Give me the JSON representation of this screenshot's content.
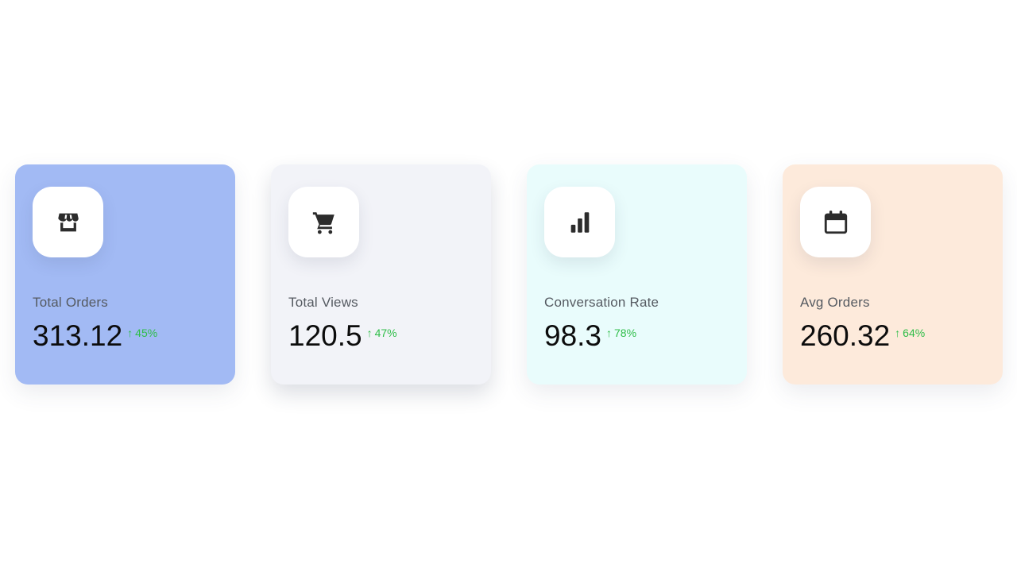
{
  "theme": {
    "positive_color": "#2ebd48",
    "icon_color": "#2c2c2c"
  },
  "cards": [
    {
      "label": "Total Orders",
      "value": "313.12",
      "change": "45%",
      "trend": "up",
      "icon": "store-icon",
      "background": "#a2baf4"
    },
    {
      "label": "Total Views",
      "value": "120.5",
      "change": "47%",
      "trend": "up",
      "icon": "cart-icon",
      "background": "#f2f3f8"
    },
    {
      "label": "Conversation Rate",
      "value": "98.3",
      "change": "78%",
      "trend": "up",
      "icon": "bar-chart-icon",
      "background": "#e9fcfc"
    },
    {
      "label": "Avg Orders",
      "value": "260.32",
      "change": "64%",
      "trend": "up",
      "icon": "calendar-icon",
      "background": "#fdeadb"
    }
  ]
}
